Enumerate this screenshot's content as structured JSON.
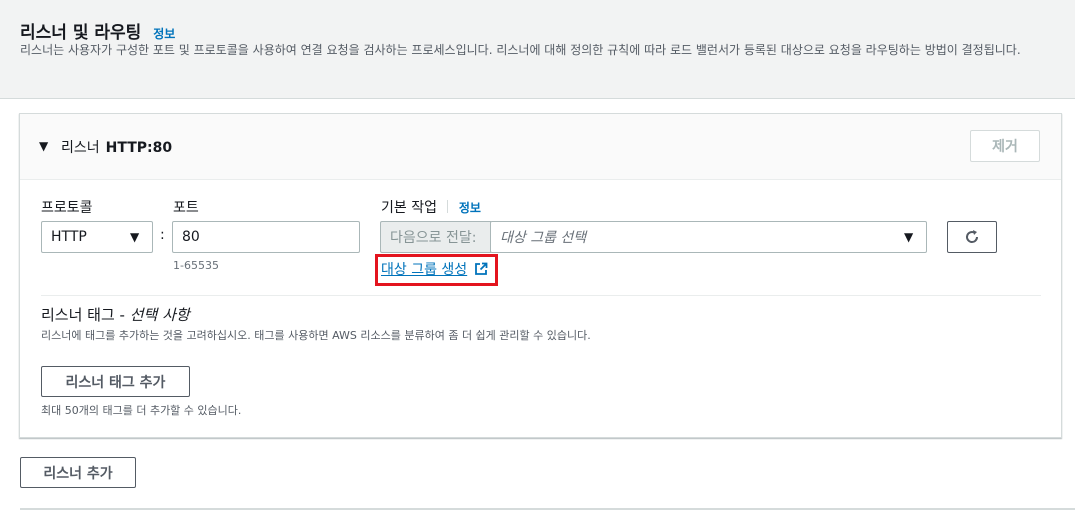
{
  "header": {
    "title": "리스너 및 라우팅",
    "info_label": "정보",
    "description": "리스너는 사용자가 구성한 포트 및 프로토콜을 사용하여 연결 요청을 검사하는 프로세스입니다. 리스너에 대해 정의한 규칙에 따라 로드 밸런서가 등록된 대상으로 요청을 라우팅하는 방법이 결정됩니다."
  },
  "listener": {
    "label": "리스너",
    "name": "HTTP:80",
    "remove_label": "제거",
    "protocol_label": "프로토콜",
    "protocol_value": "HTTP",
    "colon": ":",
    "port_label": "포트",
    "port_value": "80",
    "port_hint": "1-65535",
    "default_action_label": "기본 작업",
    "default_action_info": "정보",
    "forward_prefix": "다음으로 전달:",
    "target_group_placeholder": "대상 그룹 선택",
    "create_target_group_link": "대상 그룹 생성",
    "tags_title": "리스너 태그 - ",
    "tags_optional": "선택 사항",
    "tags_description": "리스너에 태그를 추가하는 것을 고려하십시오. 태그를 사용하면 AWS 리소스를 분류하여 좀 더 쉽게 관리할 수 있습니다.",
    "add_tag_button": "리스너 태그 추가",
    "tag_limit_hint": "최대 50개의 태그를 더 추가할 수 있습니다."
  },
  "footer": {
    "add_listener_button": "리스너 추가"
  },
  "icons": {
    "expand": "caret-down-icon",
    "select_arrow": "triangle-down-icon",
    "refresh": "refresh-icon",
    "external_link": "external-link-icon"
  },
  "colors": {
    "link": "#0073bb",
    "highlight": "#e3141e"
  }
}
